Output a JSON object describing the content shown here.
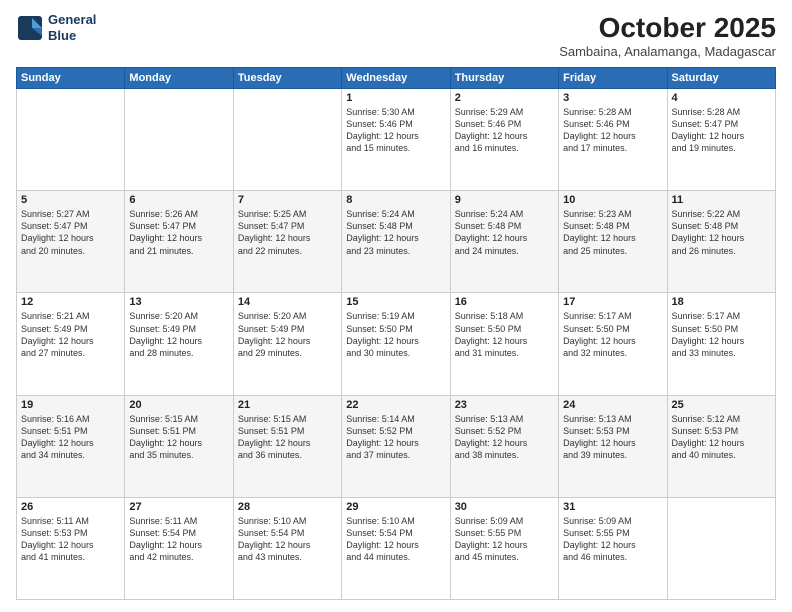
{
  "logo": {
    "line1": "General",
    "line2": "Blue"
  },
  "title": "October 2025",
  "subtitle": "Sambaina, Analamanga, Madagascar",
  "weekdays": [
    "Sunday",
    "Monday",
    "Tuesday",
    "Wednesday",
    "Thursday",
    "Friday",
    "Saturday"
  ],
  "weeks": [
    [
      {
        "day": "",
        "info": ""
      },
      {
        "day": "",
        "info": ""
      },
      {
        "day": "",
        "info": ""
      },
      {
        "day": "1",
        "info": "Sunrise: 5:30 AM\nSunset: 5:46 PM\nDaylight: 12 hours\nand 15 minutes."
      },
      {
        "day": "2",
        "info": "Sunrise: 5:29 AM\nSunset: 5:46 PM\nDaylight: 12 hours\nand 16 minutes."
      },
      {
        "day": "3",
        "info": "Sunrise: 5:28 AM\nSunset: 5:46 PM\nDaylight: 12 hours\nand 17 minutes."
      },
      {
        "day": "4",
        "info": "Sunrise: 5:28 AM\nSunset: 5:47 PM\nDaylight: 12 hours\nand 19 minutes."
      }
    ],
    [
      {
        "day": "5",
        "info": "Sunrise: 5:27 AM\nSunset: 5:47 PM\nDaylight: 12 hours\nand 20 minutes."
      },
      {
        "day": "6",
        "info": "Sunrise: 5:26 AM\nSunset: 5:47 PM\nDaylight: 12 hours\nand 21 minutes."
      },
      {
        "day": "7",
        "info": "Sunrise: 5:25 AM\nSunset: 5:47 PM\nDaylight: 12 hours\nand 22 minutes."
      },
      {
        "day": "8",
        "info": "Sunrise: 5:24 AM\nSunset: 5:48 PM\nDaylight: 12 hours\nand 23 minutes."
      },
      {
        "day": "9",
        "info": "Sunrise: 5:24 AM\nSunset: 5:48 PM\nDaylight: 12 hours\nand 24 minutes."
      },
      {
        "day": "10",
        "info": "Sunrise: 5:23 AM\nSunset: 5:48 PM\nDaylight: 12 hours\nand 25 minutes."
      },
      {
        "day": "11",
        "info": "Sunrise: 5:22 AM\nSunset: 5:48 PM\nDaylight: 12 hours\nand 26 minutes."
      }
    ],
    [
      {
        "day": "12",
        "info": "Sunrise: 5:21 AM\nSunset: 5:49 PM\nDaylight: 12 hours\nand 27 minutes."
      },
      {
        "day": "13",
        "info": "Sunrise: 5:20 AM\nSunset: 5:49 PM\nDaylight: 12 hours\nand 28 minutes."
      },
      {
        "day": "14",
        "info": "Sunrise: 5:20 AM\nSunset: 5:49 PM\nDaylight: 12 hours\nand 29 minutes."
      },
      {
        "day": "15",
        "info": "Sunrise: 5:19 AM\nSunset: 5:50 PM\nDaylight: 12 hours\nand 30 minutes."
      },
      {
        "day": "16",
        "info": "Sunrise: 5:18 AM\nSunset: 5:50 PM\nDaylight: 12 hours\nand 31 minutes."
      },
      {
        "day": "17",
        "info": "Sunrise: 5:17 AM\nSunset: 5:50 PM\nDaylight: 12 hours\nand 32 minutes."
      },
      {
        "day": "18",
        "info": "Sunrise: 5:17 AM\nSunset: 5:50 PM\nDaylight: 12 hours\nand 33 minutes."
      }
    ],
    [
      {
        "day": "19",
        "info": "Sunrise: 5:16 AM\nSunset: 5:51 PM\nDaylight: 12 hours\nand 34 minutes."
      },
      {
        "day": "20",
        "info": "Sunrise: 5:15 AM\nSunset: 5:51 PM\nDaylight: 12 hours\nand 35 minutes."
      },
      {
        "day": "21",
        "info": "Sunrise: 5:15 AM\nSunset: 5:51 PM\nDaylight: 12 hours\nand 36 minutes."
      },
      {
        "day": "22",
        "info": "Sunrise: 5:14 AM\nSunset: 5:52 PM\nDaylight: 12 hours\nand 37 minutes."
      },
      {
        "day": "23",
        "info": "Sunrise: 5:13 AM\nSunset: 5:52 PM\nDaylight: 12 hours\nand 38 minutes."
      },
      {
        "day": "24",
        "info": "Sunrise: 5:13 AM\nSunset: 5:53 PM\nDaylight: 12 hours\nand 39 minutes."
      },
      {
        "day": "25",
        "info": "Sunrise: 5:12 AM\nSunset: 5:53 PM\nDaylight: 12 hours\nand 40 minutes."
      }
    ],
    [
      {
        "day": "26",
        "info": "Sunrise: 5:11 AM\nSunset: 5:53 PM\nDaylight: 12 hours\nand 41 minutes."
      },
      {
        "day": "27",
        "info": "Sunrise: 5:11 AM\nSunset: 5:54 PM\nDaylight: 12 hours\nand 42 minutes."
      },
      {
        "day": "28",
        "info": "Sunrise: 5:10 AM\nSunset: 5:54 PM\nDaylight: 12 hours\nand 43 minutes."
      },
      {
        "day": "29",
        "info": "Sunrise: 5:10 AM\nSunset: 5:54 PM\nDaylight: 12 hours\nand 44 minutes."
      },
      {
        "day": "30",
        "info": "Sunrise: 5:09 AM\nSunset: 5:55 PM\nDaylight: 12 hours\nand 45 minutes."
      },
      {
        "day": "31",
        "info": "Sunrise: 5:09 AM\nSunset: 5:55 PM\nDaylight: 12 hours\nand 46 minutes."
      },
      {
        "day": "",
        "info": ""
      }
    ]
  ]
}
